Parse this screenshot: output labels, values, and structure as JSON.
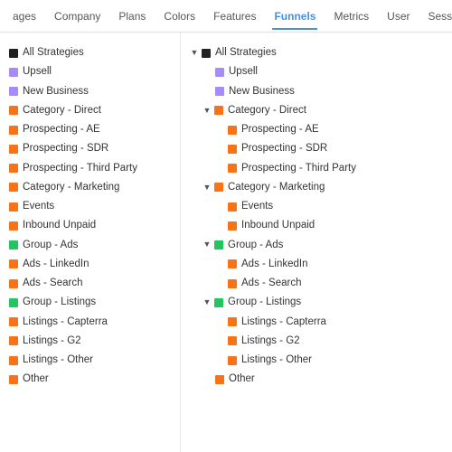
{
  "nav": {
    "items": [
      {
        "label": "ages",
        "active": false
      },
      {
        "label": "Company",
        "active": false
      },
      {
        "label": "Plans",
        "active": false
      },
      {
        "label": "Colors",
        "active": false
      },
      {
        "label": "Features",
        "active": false
      },
      {
        "label": "Funnels",
        "active": true
      },
      {
        "label": "Metrics",
        "active": false
      },
      {
        "label": "User",
        "active": false
      },
      {
        "label": "Session Prefer...",
        "active": false
      }
    ],
    "more": "..."
  },
  "left_panel": {
    "items": [
      {
        "label": "All Strategies",
        "color": "#222",
        "type": "square"
      },
      {
        "label": "Upsell",
        "color": "#a78bfa",
        "type": "square"
      },
      {
        "label": "New Business",
        "color": "#a78bfa",
        "type": "square"
      },
      {
        "label": "Category - Direct",
        "color": "#f97316",
        "type": "square"
      },
      {
        "label": "Prospecting - AE",
        "color": "#f97316",
        "type": "square"
      },
      {
        "label": "Prospecting - SDR",
        "color": "#f97316",
        "type": "square"
      },
      {
        "label": "Prospecting - Third Party",
        "color": "#f97316",
        "type": "square"
      },
      {
        "label": "Category - Marketing",
        "color": "#f97316",
        "type": "square"
      },
      {
        "label": "Events",
        "color": "#f97316",
        "type": "square"
      },
      {
        "label": "Inbound Unpaid",
        "color": "#f97316",
        "type": "square"
      },
      {
        "label": "Group - Ads",
        "color": "#22c55e",
        "type": "square"
      },
      {
        "label": "Ads - LinkedIn",
        "color": "#f97316",
        "type": "square"
      },
      {
        "label": "Ads - Search",
        "color": "#f97316",
        "type": "square"
      },
      {
        "label": "Group - Listings",
        "color": "#22c55e",
        "type": "square"
      },
      {
        "label": "Listings - Capterra",
        "color": "#f97316",
        "type": "square"
      },
      {
        "label": "Listings - G2",
        "color": "#f97316",
        "type": "square"
      },
      {
        "label": "Listings - Other",
        "color": "#f97316",
        "type": "square"
      },
      {
        "label": "Other",
        "color": "#f97316",
        "type": "square"
      }
    ]
  },
  "right_panel": {
    "items": [
      {
        "label": "All Strategies",
        "color": "#222",
        "indent": 0,
        "arrow": "down",
        "is_group": false
      },
      {
        "label": "Upsell",
        "color": "#a78bfa",
        "indent": 1,
        "arrow": null,
        "is_group": false
      },
      {
        "label": "New Business",
        "color": "#a78bfa",
        "indent": 1,
        "arrow": null,
        "is_group": false
      },
      {
        "label": "Category - Direct",
        "color": "#f97316",
        "indent": 1,
        "arrow": "down",
        "is_group": true
      },
      {
        "label": "Prospecting - AE",
        "color": "#f97316",
        "indent": 2,
        "arrow": null,
        "is_group": false
      },
      {
        "label": "Prospecting - SDR",
        "color": "#f97316",
        "indent": 2,
        "arrow": null,
        "is_group": false
      },
      {
        "label": "Prospecting - Third Party",
        "color": "#f97316",
        "indent": 2,
        "arrow": null,
        "is_group": false
      },
      {
        "label": "Category - Marketing",
        "color": "#f97316",
        "indent": 1,
        "arrow": "down",
        "is_group": true
      },
      {
        "label": "Events",
        "color": "#f97316",
        "indent": 2,
        "arrow": null,
        "is_group": false
      },
      {
        "label": "Inbound Unpaid",
        "color": "#f97316",
        "indent": 2,
        "arrow": null,
        "is_group": false
      },
      {
        "label": "Group - Ads",
        "color": "#22c55e",
        "indent": 1,
        "arrow": "down",
        "is_group": true
      },
      {
        "label": "Ads - LinkedIn",
        "color": "#f97316",
        "indent": 2,
        "arrow": null,
        "is_group": false
      },
      {
        "label": "Ads - Search",
        "color": "#f97316",
        "indent": 2,
        "arrow": null,
        "is_group": false
      },
      {
        "label": "Group - Listings",
        "color": "#22c55e",
        "indent": 1,
        "arrow": "down",
        "is_group": true
      },
      {
        "label": "Listings - Capterra",
        "color": "#f97316",
        "indent": 2,
        "arrow": null,
        "is_group": false
      },
      {
        "label": "Listings - G2",
        "color": "#f97316",
        "indent": 2,
        "arrow": null,
        "is_group": false
      },
      {
        "label": "Listings - Other",
        "color": "#f97316",
        "indent": 2,
        "arrow": null,
        "is_group": false
      },
      {
        "label": "Other",
        "color": "#f97316",
        "indent": 1,
        "arrow": null,
        "is_group": false
      }
    ]
  }
}
